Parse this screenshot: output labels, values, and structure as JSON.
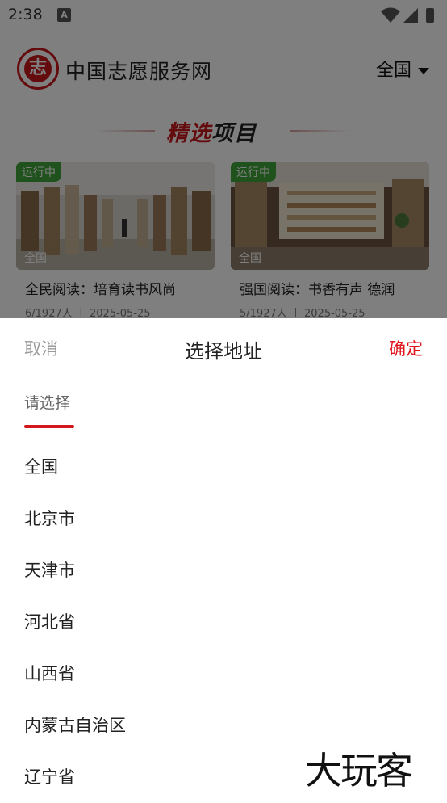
{
  "status_bar": {
    "time": "2:38",
    "notification_icon": "A"
  },
  "header": {
    "title": "中国志愿服务网",
    "logo_char": "志",
    "region": "全国"
  },
  "section": {
    "title_part1": "精选",
    "title_part2": "项目"
  },
  "cards": [
    {
      "badge": "运行中",
      "region": "全国",
      "title": "全民阅读：培育读书风尚",
      "meta": "6/1927人 丨 2025-05-25"
    },
    {
      "badge": "运行中",
      "region": "全国",
      "title": "强国阅读：书香有声 德润",
      "meta": "5/1927人 丨 2025-05-25"
    }
  ],
  "picker": {
    "cancel": "取消",
    "title": "选择地址",
    "confirm": "确定",
    "tab": "请选择",
    "items": [
      "全国",
      "北京市",
      "天津市",
      "河北省",
      "山西省",
      "内蒙古自治区",
      "辽宁省"
    ]
  },
  "watermark": "大玩客",
  "colors": {
    "accent": "#c8161d",
    "badge": "#3fa53a",
    "confirm": "#e0161d"
  }
}
